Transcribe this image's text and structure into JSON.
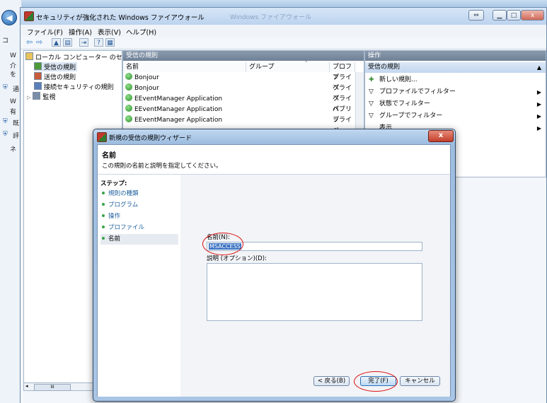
{
  "bg_fragments": [
    "W",
    "介",
    "を",
    "W",
    "有",
    "ネ",
    "コ",
    "通",
    "既",
    "評"
  ],
  "window": {
    "title": "セキュリティが強化された Windows ファイアウォール",
    "faded_title_fragment": "Windows ファイアウォール",
    "menu": [
      "ファイル(F)",
      "操作(A)",
      "表示(V)",
      "ヘルプ(H)"
    ]
  },
  "tree": {
    "root": "ローカル コンピューター のセ",
    "items": [
      "受信の規則",
      "送信の規則",
      "接続セキュリティの規則",
      "監視"
    ],
    "scroll_label": "III"
  },
  "rules": {
    "header": "受信の規則",
    "columns": [
      "名前",
      "グループ",
      "プロファ"
    ],
    "rows": [
      {
        "name": "Bonjour",
        "profile": "プライベ"
      },
      {
        "name": "Bonjour",
        "profile": "プライベ"
      },
      {
        "name": "EEventManager Application",
        "profile": "プライベ"
      },
      {
        "name": "EEventManager Application",
        "profile": "パブリッ"
      },
      {
        "name": "EEventManager Application",
        "profile": "プライベ"
      }
    ]
  },
  "actions": {
    "header": "操作",
    "section": "受信の規則",
    "items": [
      "新しい規則...",
      "プロファイルでフィルター",
      "状態でフィルター",
      "グループでフィルター",
      "表示"
    ]
  },
  "dialog": {
    "title": "新規の受信の規則ウィザード",
    "close": "x",
    "heading": "名前",
    "subtitle": "この規則の名前と説明を指定してください。",
    "steps_title": "ステップ:",
    "steps": [
      "規則の種類",
      "プログラム",
      "操作",
      "プロファイル",
      "名前"
    ],
    "name_label": "名前(N):",
    "name_value": "MSACCESS",
    "desc_label": "説明 (オプション)(D):",
    "back_button": "< 戻る(B)",
    "finish_button": "完了(F)",
    "cancel_button": "キャンセル"
  }
}
